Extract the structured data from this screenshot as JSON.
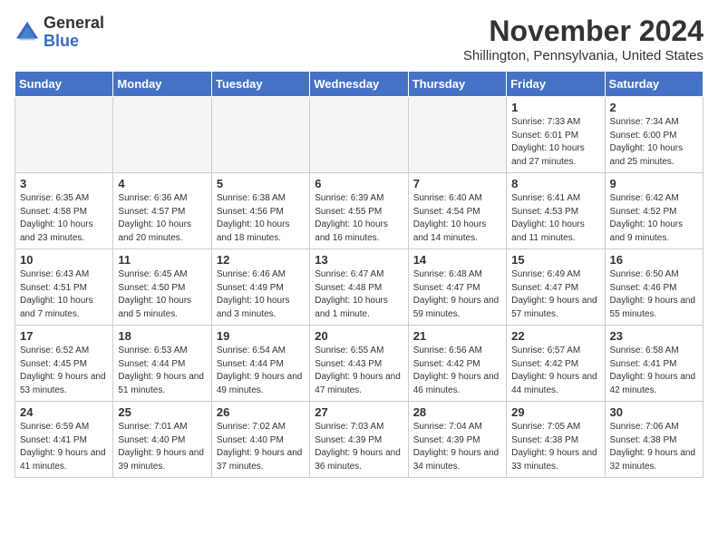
{
  "header": {
    "logo_general": "General",
    "logo_blue": "Blue",
    "title": "November 2024",
    "location": "Shillington, Pennsylvania, United States"
  },
  "days_of_week": [
    "Sunday",
    "Monday",
    "Tuesday",
    "Wednesday",
    "Thursday",
    "Friday",
    "Saturday"
  ],
  "weeks": [
    [
      {
        "day": "",
        "empty": true
      },
      {
        "day": "",
        "empty": true
      },
      {
        "day": "",
        "empty": true
      },
      {
        "day": "",
        "empty": true
      },
      {
        "day": "",
        "empty": true
      },
      {
        "day": "1",
        "info": "Sunrise: 7:33 AM\nSunset: 6:01 PM\nDaylight: 10 hours\nand 27 minutes."
      },
      {
        "day": "2",
        "info": "Sunrise: 7:34 AM\nSunset: 6:00 PM\nDaylight: 10 hours\nand 25 minutes."
      }
    ],
    [
      {
        "day": "3",
        "info": "Sunrise: 6:35 AM\nSunset: 4:58 PM\nDaylight: 10 hours\nand 23 minutes."
      },
      {
        "day": "4",
        "info": "Sunrise: 6:36 AM\nSunset: 4:57 PM\nDaylight: 10 hours\nand 20 minutes."
      },
      {
        "day": "5",
        "info": "Sunrise: 6:38 AM\nSunset: 4:56 PM\nDaylight: 10 hours\nand 18 minutes."
      },
      {
        "day": "6",
        "info": "Sunrise: 6:39 AM\nSunset: 4:55 PM\nDaylight: 10 hours\nand 16 minutes."
      },
      {
        "day": "7",
        "info": "Sunrise: 6:40 AM\nSunset: 4:54 PM\nDaylight: 10 hours\nand 14 minutes."
      },
      {
        "day": "8",
        "info": "Sunrise: 6:41 AM\nSunset: 4:53 PM\nDaylight: 10 hours\nand 11 minutes."
      },
      {
        "day": "9",
        "info": "Sunrise: 6:42 AM\nSunset: 4:52 PM\nDaylight: 10 hours\nand 9 minutes."
      }
    ],
    [
      {
        "day": "10",
        "info": "Sunrise: 6:43 AM\nSunset: 4:51 PM\nDaylight: 10 hours\nand 7 minutes."
      },
      {
        "day": "11",
        "info": "Sunrise: 6:45 AM\nSunset: 4:50 PM\nDaylight: 10 hours\nand 5 minutes."
      },
      {
        "day": "12",
        "info": "Sunrise: 6:46 AM\nSunset: 4:49 PM\nDaylight: 10 hours\nand 3 minutes."
      },
      {
        "day": "13",
        "info": "Sunrise: 6:47 AM\nSunset: 4:48 PM\nDaylight: 10 hours\nand 1 minute."
      },
      {
        "day": "14",
        "info": "Sunrise: 6:48 AM\nSunset: 4:47 PM\nDaylight: 9 hours\nand 59 minutes."
      },
      {
        "day": "15",
        "info": "Sunrise: 6:49 AM\nSunset: 4:47 PM\nDaylight: 9 hours\nand 57 minutes."
      },
      {
        "day": "16",
        "info": "Sunrise: 6:50 AM\nSunset: 4:46 PM\nDaylight: 9 hours\nand 55 minutes."
      }
    ],
    [
      {
        "day": "17",
        "info": "Sunrise: 6:52 AM\nSunset: 4:45 PM\nDaylight: 9 hours\nand 53 minutes."
      },
      {
        "day": "18",
        "info": "Sunrise: 6:53 AM\nSunset: 4:44 PM\nDaylight: 9 hours\nand 51 minutes."
      },
      {
        "day": "19",
        "info": "Sunrise: 6:54 AM\nSunset: 4:44 PM\nDaylight: 9 hours\nand 49 minutes."
      },
      {
        "day": "20",
        "info": "Sunrise: 6:55 AM\nSunset: 4:43 PM\nDaylight: 9 hours\nand 47 minutes."
      },
      {
        "day": "21",
        "info": "Sunrise: 6:56 AM\nSunset: 4:42 PM\nDaylight: 9 hours\nand 46 minutes."
      },
      {
        "day": "22",
        "info": "Sunrise: 6:57 AM\nSunset: 4:42 PM\nDaylight: 9 hours\nand 44 minutes."
      },
      {
        "day": "23",
        "info": "Sunrise: 6:58 AM\nSunset: 4:41 PM\nDaylight: 9 hours\nand 42 minutes."
      }
    ],
    [
      {
        "day": "24",
        "info": "Sunrise: 6:59 AM\nSunset: 4:41 PM\nDaylight: 9 hours\nand 41 minutes."
      },
      {
        "day": "25",
        "info": "Sunrise: 7:01 AM\nSunset: 4:40 PM\nDaylight: 9 hours\nand 39 minutes."
      },
      {
        "day": "26",
        "info": "Sunrise: 7:02 AM\nSunset: 4:40 PM\nDaylight: 9 hours\nand 37 minutes."
      },
      {
        "day": "27",
        "info": "Sunrise: 7:03 AM\nSunset: 4:39 PM\nDaylight: 9 hours\nand 36 minutes."
      },
      {
        "day": "28",
        "info": "Sunrise: 7:04 AM\nSunset: 4:39 PM\nDaylight: 9 hours\nand 34 minutes."
      },
      {
        "day": "29",
        "info": "Sunrise: 7:05 AM\nSunset: 4:38 PM\nDaylight: 9 hours\nand 33 minutes."
      },
      {
        "day": "30",
        "info": "Sunrise: 7:06 AM\nSunset: 4:38 PM\nDaylight: 9 hours\nand 32 minutes."
      }
    ]
  ]
}
